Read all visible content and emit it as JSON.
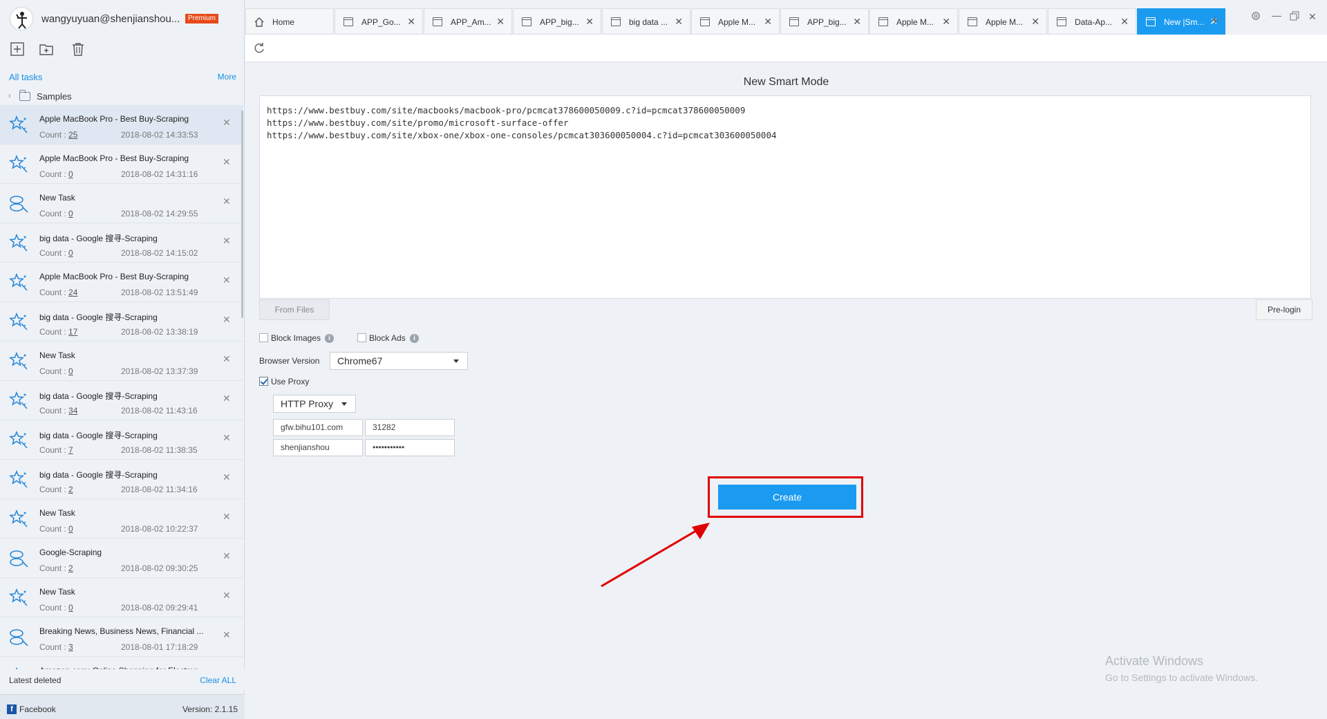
{
  "user": {
    "name": "wangyuyuan@shenjianshou...",
    "badge": "Premium"
  },
  "sidebar": {
    "all_tasks": "All tasks",
    "more": "More",
    "samples": "Samples",
    "latest_deleted": "Latest deleted",
    "clear_all": "Clear ALL",
    "facebook": "Facebook",
    "version": "Version: 2.1.15",
    "tasks": [
      {
        "title": "Apple MacBook Pro - Best Buy-Scraping",
        "count_label": "Count :",
        "count": "25",
        "time": "2018-08-02 14:33:53",
        "icon": "smart-star-icon",
        "selected": true
      },
      {
        "title": "Apple MacBook Pro - Best Buy-Scraping",
        "count_label": "Count :",
        "count": "0",
        "time": "2018-08-02 14:31:16",
        "icon": "smart-star-icon"
      },
      {
        "title": "New Task",
        "count_label": "Count :",
        "count": "0",
        "time": "2018-08-02 14:29:55",
        "icon": "workflow-icon"
      },
      {
        "title": "big data - Google 搜寻-Scraping",
        "count_label": "Count :",
        "count": "0",
        "time": "2018-08-02 14:15:02",
        "icon": "smart-star-icon"
      },
      {
        "title": "Apple MacBook Pro - Best Buy-Scraping",
        "count_label": "Count :",
        "count": "24",
        "time": "2018-08-02 13:51:49",
        "icon": "smart-star-icon"
      },
      {
        "title": "big data - Google 搜寻-Scraping",
        "count_label": "Count :",
        "count": "17",
        "time": "2018-08-02 13:38:19",
        "icon": "smart-star-icon"
      },
      {
        "title": "New Task",
        "count_label": "Count :",
        "count": "0",
        "time": "2018-08-02 13:37:39",
        "icon": "smart-star-icon"
      },
      {
        "title": "big data - Google 搜寻-Scraping",
        "count_label": "Count :",
        "count": "34",
        "time": "2018-08-02 11:43:16",
        "icon": "smart-star-icon"
      },
      {
        "title": "big data - Google 搜寻-Scraping",
        "count_label": "Count :",
        "count": "7",
        "time": "2018-08-02 11:38:35",
        "icon": "smart-star-icon"
      },
      {
        "title": "big data - Google 搜寻-Scraping",
        "count_label": "Count :",
        "count": "2",
        "time": "2018-08-02 11:34:16",
        "icon": "smart-star-icon"
      },
      {
        "title": "New Task",
        "count_label": "Count :",
        "count": "0",
        "time": "2018-08-02 10:22:37",
        "icon": "smart-star-icon"
      },
      {
        "title": "Google-Scraping",
        "count_label": "Count :",
        "count": "2",
        "time": "2018-08-02 09:30:25",
        "icon": "workflow-icon"
      },
      {
        "title": "New Task",
        "count_label": "Count :",
        "count": "0",
        "time": "2018-08-02 09:29:41",
        "icon": "smart-star-icon"
      },
      {
        "title": "Breaking News, Business News, Financial ...",
        "count_label": "Count :",
        "count": "3",
        "time": "2018-08-01 17:18:29",
        "icon": "workflow-icon"
      },
      {
        "title": "Amazon.com: Online Shopping for Electron...",
        "count_label": "Count :",
        "count": "",
        "time": "",
        "icon": "smart-star-icon"
      }
    ]
  },
  "tabs": [
    {
      "label": "Home",
      "icon": "home-icon"
    },
    {
      "label": "APP_Go...",
      "icon": "window-icon"
    },
    {
      "label": "APP_Am...",
      "icon": "window-icon"
    },
    {
      "label": "APP_big...",
      "icon": "window-icon"
    },
    {
      "label": "big data ...",
      "icon": "window-icon"
    },
    {
      "label": "Apple M...",
      "icon": "window-icon"
    },
    {
      "label": "APP_big...",
      "icon": "window-icon"
    },
    {
      "label": "Apple M...",
      "icon": "window-icon"
    },
    {
      "label": "Apple M...",
      "icon": "window-icon"
    },
    {
      "label": "Data-Ap...",
      "icon": "window-icon"
    },
    {
      "label": "New |Sm...",
      "icon": "window-icon",
      "active": true
    }
  ],
  "main": {
    "title": "New Smart Mode",
    "urls": "https://www.bestbuy.com/site/macbooks/macbook-pro/pcmcat378600050009.c?id=pcmcat378600050009\nhttps://www.bestbuy.com/site/promo/microsoft-surface-offer\nhttps://www.bestbuy.com/site/xbox-one/xbox-one-consoles/pcmcat303600050004.c?id=pcmcat303600050004",
    "from_files": "From Files",
    "pre_login": "Pre-login",
    "block_images": "Block Images",
    "block_ads": "Block Ads",
    "browser_version_label": "Browser Version",
    "browser_version": "Chrome67",
    "use_proxy": "Use Proxy",
    "proxy_type": "HTTP Proxy",
    "proxy_host": "gfw.bihu101.com",
    "proxy_port": "31282",
    "proxy_user": "shenjianshou",
    "proxy_pass": "•••••••••••",
    "create": "Create"
  },
  "watermark": {
    "line1": "Activate Windows",
    "line2": "Go to Settings to activate Windows."
  },
  "colors": {
    "accent": "#1a9bf0",
    "highlight": "#e00000",
    "link": "#1a8ee6"
  }
}
